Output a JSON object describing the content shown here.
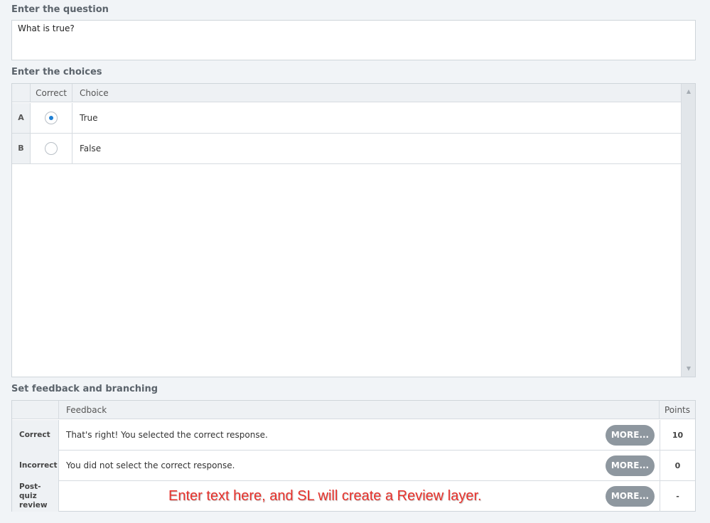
{
  "question": {
    "label": "Enter the question",
    "value": "What is true?"
  },
  "choices": {
    "label": "Enter the choices",
    "headers": {
      "correct": "Correct",
      "choice": "Choice"
    },
    "rows": [
      {
        "index": "A",
        "checked": true,
        "text": "True"
      },
      {
        "index": "B",
        "checked": false,
        "text": "False"
      }
    ],
    "scroll_up_icon": "▲",
    "scroll_down_icon": "▼"
  },
  "feedback": {
    "label": "Set feedback and branching",
    "headers": {
      "feedback": "Feedback",
      "points": "Points"
    },
    "rows": [
      {
        "label": "Correct",
        "text": "That's right!  You selected the correct response.",
        "more": "MORE...",
        "points": "10"
      },
      {
        "label": "Incorrect",
        "text": "You did not select the correct response.",
        "more": "MORE...",
        "points": "0"
      },
      {
        "label": "Post-quiz review",
        "text": "",
        "more": "MORE...",
        "points": "-"
      }
    ]
  },
  "annotation": "Enter text here, and SL will create a Review layer.",
  "colors": {
    "background": "#f1f4f7",
    "radio_accent": "#1e7fd3",
    "more_button": "#8e979f",
    "annotation": "#e8312b"
  }
}
